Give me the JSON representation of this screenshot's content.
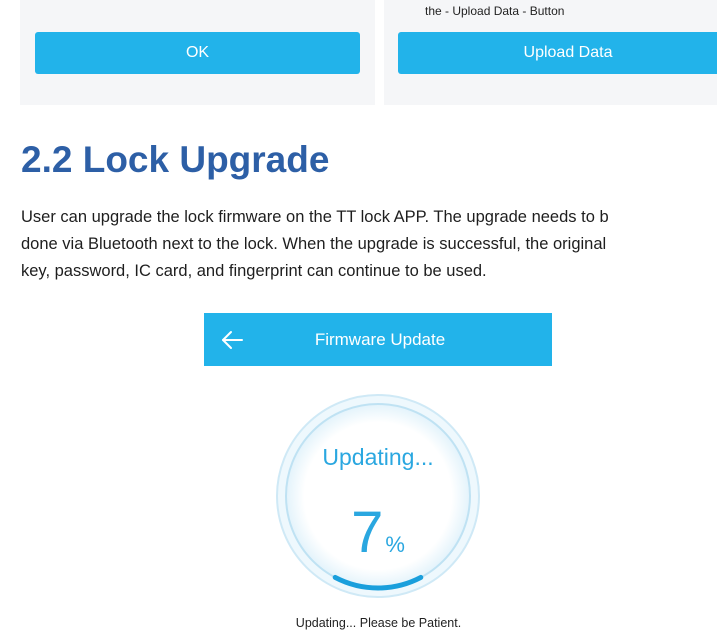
{
  "top_panels": {
    "left": {
      "ok_label": "OK"
    },
    "right": {
      "note": "the - Upload Data - Button",
      "upload_label": "Upload Data"
    }
  },
  "section": {
    "heading": "2.2 Lock Upgrade",
    "paragraph_lines": [
      "User can upgrade the lock firmware on the TT lock APP. The upgrade needs to b",
      "done via Bluetooth next to the lock. When the upgrade is successful, the original",
      "key, password, IC card, and fingerprint can continue to be used."
    ]
  },
  "firmware_screen": {
    "title": "Firmware Update",
    "back_icon": "arrow-left-icon",
    "status": "Updating...",
    "progress_value": "7",
    "progress_unit": "%",
    "progress_fraction": 0.07,
    "patience_note": "Updating... Please be Patient."
  },
  "colors": {
    "accent": "#22b3ea",
    "heading": "#2d5fa6",
    "ring": "#2aa7e0"
  }
}
